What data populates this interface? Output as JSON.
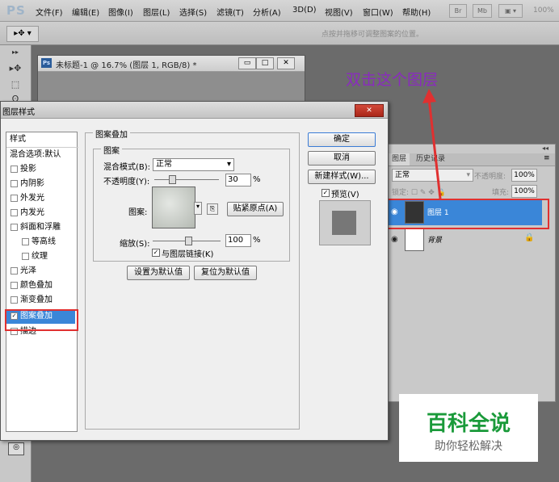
{
  "app": {
    "logo": "PS",
    "zoom": "100%"
  },
  "menubar": {
    "items": [
      "文件(F)",
      "编辑(E)",
      "图像(I)",
      "图层(L)",
      "选择(S)",
      "滤镜(T)",
      "分析(A)",
      "3D(D)",
      "视图(V)",
      "窗口(W)",
      "帮助(H)"
    ],
    "br_label": "Br",
    "mb_label": "Mb"
  },
  "options_bar": {
    "hint": "点按并拖移可调整图案的位置。"
  },
  "document": {
    "title": "未标题-1 @ 16.7% (图层 1, RGB/8) *"
  },
  "annotation": {
    "text": "双击这个图层",
    "color": "#8a2bbf"
  },
  "layers_panel": {
    "tabs": [
      "图层",
      "历史记录"
    ],
    "blend_mode": "正常",
    "opacity_label": "不透明度:",
    "opacity_value": "100%",
    "lock_label": "锁定:",
    "fill_label": "填充:",
    "fill_value": "100%",
    "layers": [
      {
        "name": "图层 1",
        "selected": true
      },
      {
        "name": "背景",
        "selected": false
      }
    ]
  },
  "dialog": {
    "title": "图层样式",
    "styles_header": "样式",
    "styles": [
      {
        "label": "混合选项:默认",
        "checkbox": false
      },
      {
        "label": "投影",
        "checkbox": true,
        "checked": false
      },
      {
        "label": "内阴影",
        "checkbox": true,
        "checked": false
      },
      {
        "label": "外发光",
        "checkbox": true,
        "checked": false
      },
      {
        "label": "内发光",
        "checkbox": true,
        "checked": false
      },
      {
        "label": "斜面和浮雕",
        "checkbox": true,
        "checked": false
      },
      {
        "label": "等高线",
        "checkbox": true,
        "checked": false
      },
      {
        "label": "纹理",
        "checkbox": true,
        "checked": false
      },
      {
        "label": "光泽",
        "checkbox": true,
        "checked": false
      },
      {
        "label": "颜色叠加",
        "checkbox": true,
        "checked": false
      },
      {
        "label": "渐变叠加",
        "checkbox": true,
        "checked": false
      },
      {
        "label": "图案叠加",
        "checkbox": true,
        "checked": true,
        "selected": true
      },
      {
        "label": "描边",
        "checkbox": true,
        "checked": false
      }
    ],
    "group_title": "图案叠加",
    "subgroup_title": "图案",
    "blend_mode_label": "混合模式(B):",
    "blend_mode_value": "正常",
    "opacity_label": "不透明度(Y):",
    "opacity_value": "30",
    "percent": "%",
    "pattern_label": "图案:",
    "snap_button": "贴紧原点(A)",
    "scale_label": "缩放(S):",
    "scale_value": "100",
    "link_label": "与图层链接(K)",
    "link_checked": true,
    "default_button": "设置为默认值",
    "reset_button": "复位为默认值",
    "ok_button": "确定",
    "cancel_button": "取消",
    "new_style_button": "新建样式(W)...",
    "preview_label": "预览(V)",
    "preview_checked": true
  },
  "watermark": {
    "main": "百科全说",
    "sub": "助你轻松解决"
  }
}
